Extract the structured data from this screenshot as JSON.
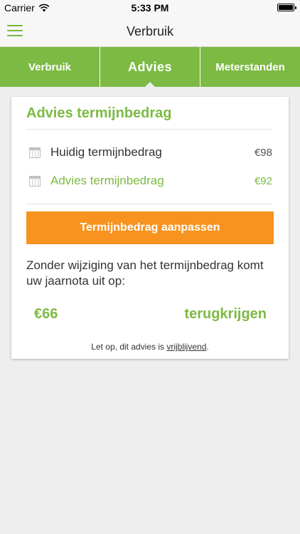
{
  "status_bar": {
    "carrier": "Carrier",
    "time": "5:33 PM"
  },
  "navbar": {
    "title": "Verbruik",
    "menu_icon": "hamburger-menu-icon"
  },
  "tabs": [
    {
      "label": "Verbruik",
      "active": false
    },
    {
      "label": "Advies",
      "active": true
    },
    {
      "label": "Meterstanden",
      "active": false
    }
  ],
  "card": {
    "title": "Advies termijnbedrag",
    "rows": [
      {
        "label": "Huidig termijnbedrag",
        "amount": "€98",
        "icon": "calendar-icon"
      },
      {
        "label": "Advies termijnbedrag",
        "amount": "€92",
        "icon": "calendar-icon"
      }
    ],
    "button_label": "Termijnbedrag aanpassen",
    "explanation": "Zonder wijziging van het termijnbedrag komt uw jaarnota uit op:",
    "result_amount": "€66",
    "result_text": "terugkrijgen",
    "disclaimer_prefix": "Let op, dit advies is ",
    "disclaimer_link": "vrijblijvend",
    "disclaimer_suffix": "."
  },
  "colors": {
    "brand_green": "#7cba43",
    "accent_orange": "#f7931e"
  }
}
